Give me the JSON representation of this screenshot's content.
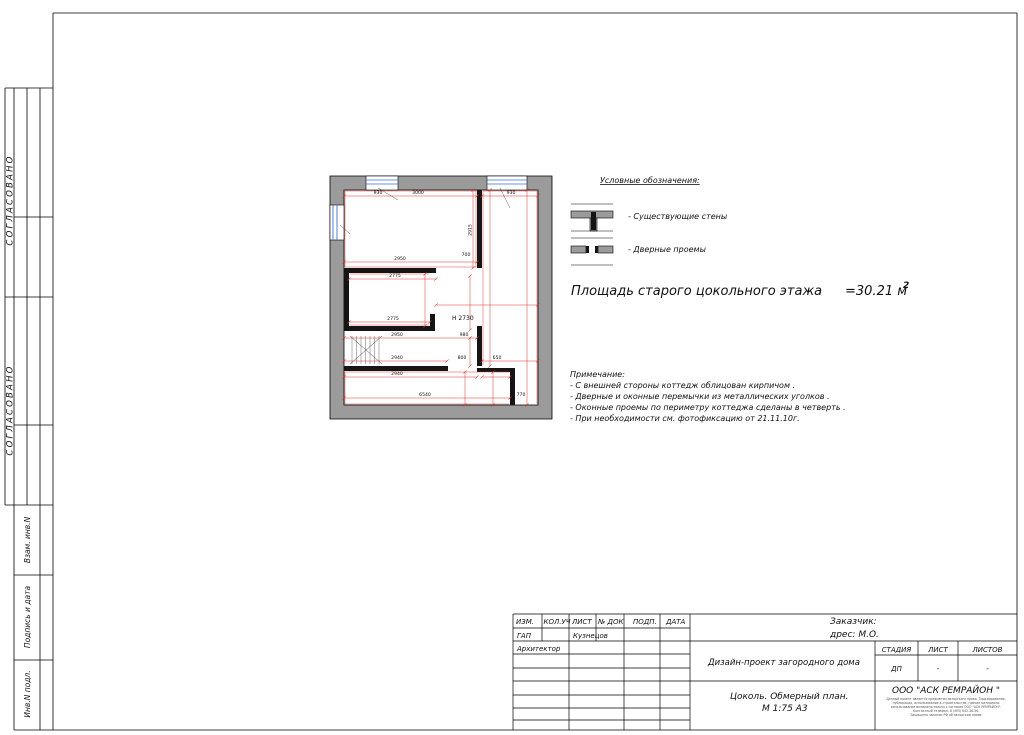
{
  "left_stamp": {
    "agreed_top": "СОГЛАСОВАНО",
    "agreed_bottom": "СОГЛАСОВАНО",
    "replace_inv": "Взам. инв.N",
    "sign_date": "Подпись и дата",
    "inv_orig": "Инв.N подл."
  },
  "plan": {
    "height_label": "H 2730",
    "dims": [
      "930",
      "3000",
      "930",
      "2950",
      "700",
      "2775",
      "2775",
      "2950",
      "980",
      "2940",
      "800",
      "650",
      "2940",
      "6540",
      "770",
      "2915"
    ]
  },
  "legend": {
    "title": "Условные обозначения:",
    "walls": "- Существующие стены",
    "doors": "- Дверные проемы"
  },
  "area": {
    "label": "Площадь старого цокольного этажа",
    "value": "=30.21 м",
    "unit_power": "2"
  },
  "notes": {
    "title": "Примечание:",
    "lines": [
      "- С внешней стороны коттедж облицован кирпичом .",
      "- Дверные и оконные перемычки из металлических уголков .",
      "- Оконные проемы по периметру коттеджа сделаны в четверть .",
      "- При необходимости см. фотофиксацию от 21.11.10г."
    ]
  },
  "title_block": {
    "headers": [
      "ИЗМ.",
      "КОЛ.УЧ",
      "ЛИСТ",
      "№ ДОК",
      "ПОДП.",
      "ДАТА"
    ],
    "rows": [
      {
        "role": "ГАП",
        "name": "Кузнецов"
      },
      {
        "role": "Архитектор"
      }
    ],
    "customer": "Заказчик:",
    "address": "дрес: М.О.",
    "project": "Дизайн-проект загородного дома",
    "stage_header": "СТАДИЯ",
    "sheet_header": "ЛИСТ",
    "sheets_header": "ЛИСТОВ",
    "stage": "ДП",
    "sheet": "-",
    "sheets": "-",
    "drawing_title": "Цоколь. Обмерный план.",
    "scale": "М 1:75 А3",
    "company": "ООО \"АСК РЕМРАЙОН \"",
    "copyright": [
      "Данный проект является предметом авторского права. Тиражирование,",
      "публикация, использование в строительстве, прочие материалы",
      "использование возможно только с согласия ООО \"АСК РЕМРАЙОН\".",
      "Контактный телефон: 8 (495) 642-36-56.",
      "Защищено законом РФ об авторском праве"
    ]
  },
  "colors": {
    "line": "#000000",
    "wall": "#9b9b9b",
    "interior_wall": "#151515",
    "dimension": "#e0302b",
    "window": "#3c6ee0"
  }
}
